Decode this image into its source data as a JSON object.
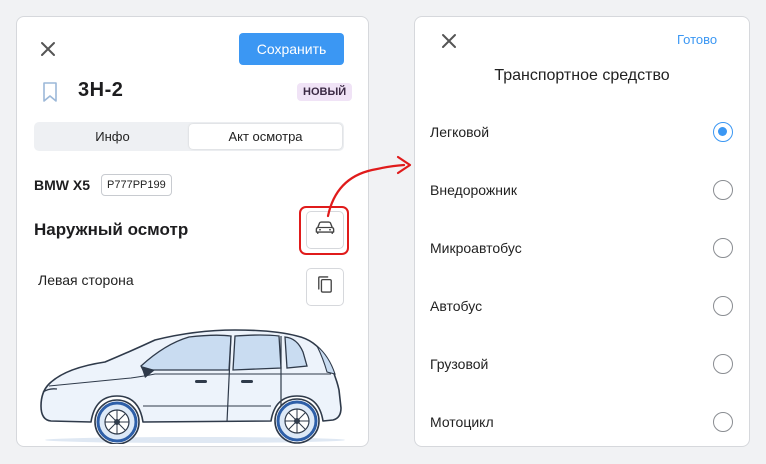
{
  "colors": {
    "accent": "#3b97f3",
    "highlight": "#e01b1b",
    "badge_bg": "#f0e3f6"
  },
  "left_panel": {
    "save_label": "Сохранить",
    "title": "3Н-2",
    "badge": "НОВЫЙ",
    "tabs": [
      {
        "label": "Инфо",
        "active": false
      },
      {
        "label": "Акт осмотра",
        "active": true
      }
    ],
    "vehicle": {
      "model": "BMW X5",
      "plate": "Р777РР199"
    },
    "section_title": "Наружный осмотр",
    "side_label": "Левая сторона",
    "icons": {
      "close": "close-icon",
      "bookmark": "bookmark-icon",
      "vehicle_type": "car-icon",
      "copy": "copy-icon"
    }
  },
  "right_panel": {
    "done_label": "Готово",
    "title": "Транспортное средство",
    "options": [
      {
        "label": "Легковой",
        "selected": true
      },
      {
        "label": "Внедорожник",
        "selected": false
      },
      {
        "label": "Микроавтобус",
        "selected": false
      },
      {
        "label": "Автобус",
        "selected": false
      },
      {
        "label": "Грузовой",
        "selected": false
      },
      {
        "label": "Мотоцикл",
        "selected": false
      }
    ]
  }
}
